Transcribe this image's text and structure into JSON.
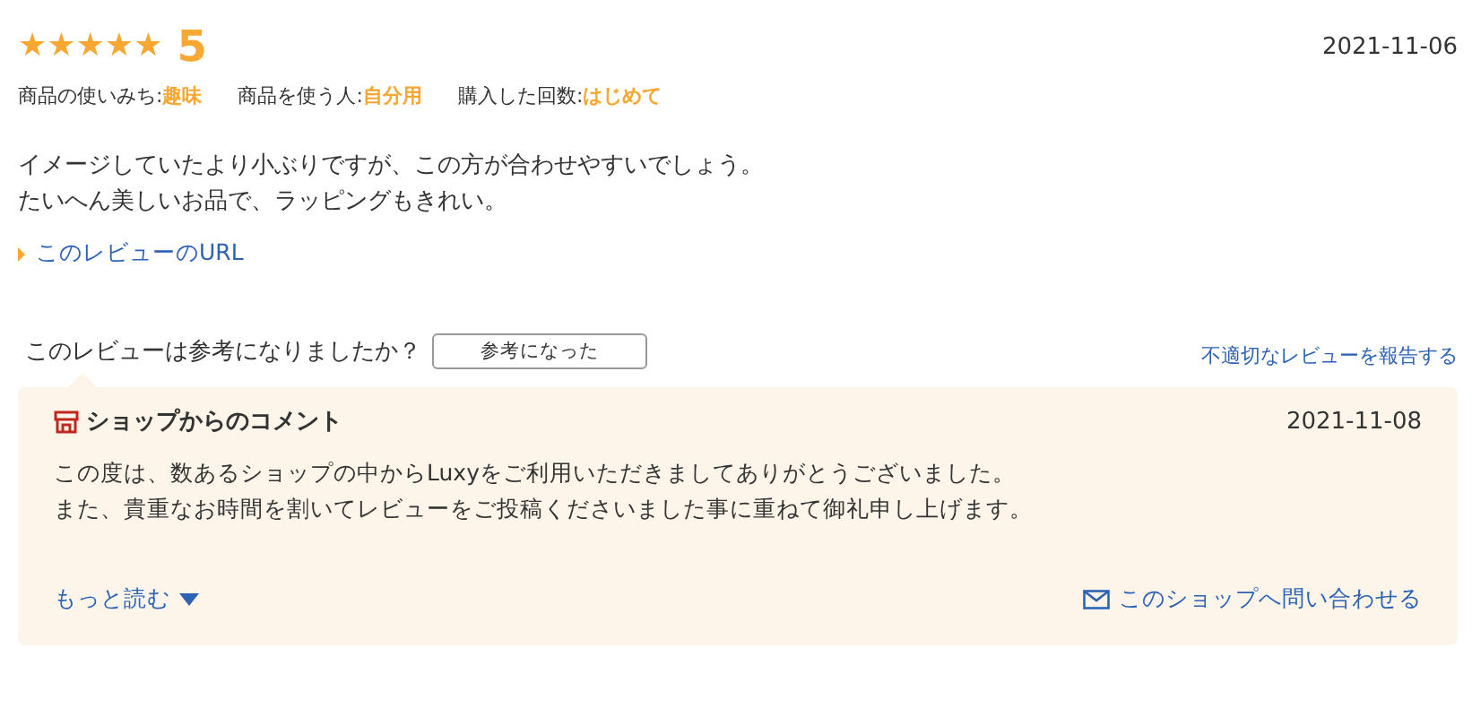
{
  "review": {
    "stars": 5,
    "rating": "5",
    "date": "2021-11-06",
    "attributes": [
      {
        "label": "商品の使いみち:",
        "value": "趣味"
      },
      {
        "label": "商品を使う人:",
        "value": "自分用"
      },
      {
        "label": "購入した回数:",
        "value": "はじめて"
      }
    ],
    "body": [
      "イメージしていたより小ぶりですが、この方が合わせやすいでしょう。",
      "たいへん美しいお品で、ラッピングもきれい。"
    ],
    "url_link": "このレビューのURL",
    "helpful_question": "このレビューは参考になりましたか？",
    "helpful_button": "参考になった",
    "report_link": "不適切なレビューを報告する"
  },
  "shop_comment": {
    "title": "ショップからのコメント",
    "date": "2021-11-08",
    "body": [
      "この度は、数あるショップの中からLuxyをご利用いただきましてありがとうございました。",
      "また、貴重なお時間を割いてレビューをご投稿くださいました事に重ねて御礼申し上げます。"
    ],
    "more_link": "もっと読む",
    "contact_link": "このショップへ問い合わせる"
  }
}
